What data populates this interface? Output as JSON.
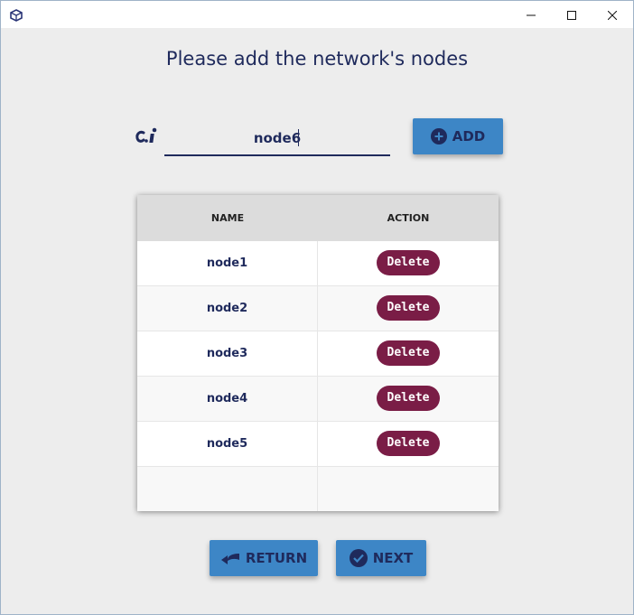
{
  "window": {
    "icons": {
      "app": "app-cube-icon",
      "minimize": "minimize-icon",
      "maximize": "maximize-icon",
      "close": "close-icon"
    }
  },
  "heading": "Please add the network's nodes",
  "input": {
    "value": "node6",
    "icon": "input-text-icon"
  },
  "add_button": {
    "label": "ADD",
    "icon": "plus-circle-icon"
  },
  "table": {
    "columns": [
      "NAME",
      "ACTION"
    ],
    "rows": [
      {
        "name": "node1",
        "action": "Delete"
      },
      {
        "name": "node2",
        "action": "Delete"
      },
      {
        "name": "node3",
        "action": "Delete"
      },
      {
        "name": "node4",
        "action": "Delete"
      },
      {
        "name": "node5",
        "action": "Delete"
      }
    ]
  },
  "footer": {
    "return_label": "RETURN",
    "return_icon": "return-arrow-icon",
    "next_label": "NEXT",
    "next_icon": "check-circle-icon"
  },
  "colors": {
    "accent": "#3d86c6",
    "text": "#1f2a5c",
    "delete": "#7a1d46",
    "background": "#ededed"
  }
}
